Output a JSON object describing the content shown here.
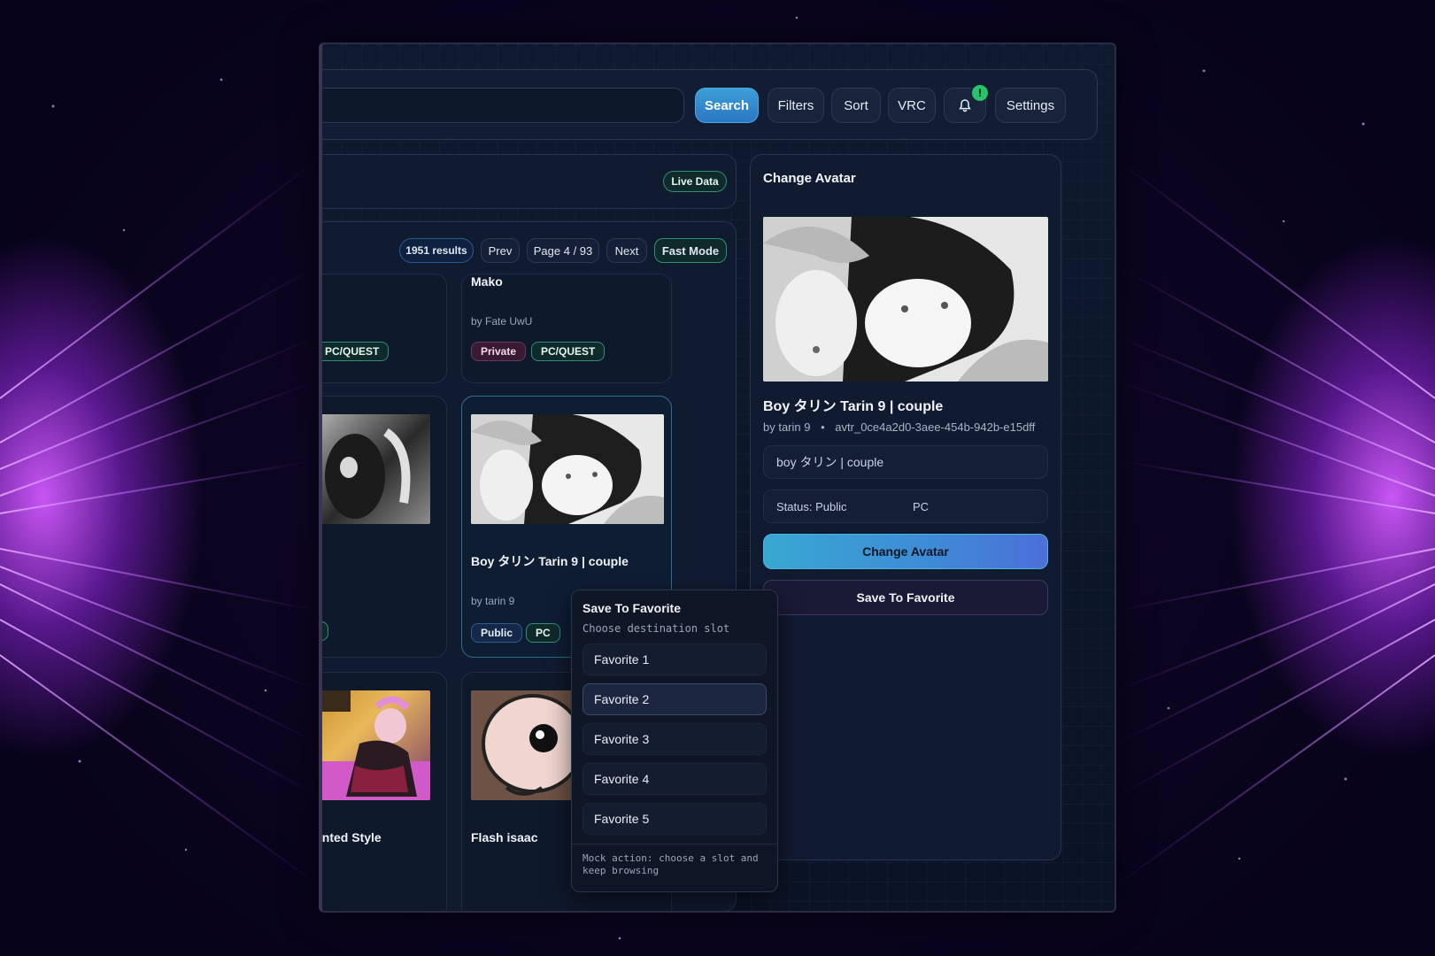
{
  "toolbar": {
    "search_placeholder": "",
    "search_label": "Search",
    "filters_label": "Filters",
    "sort_label": "Sort",
    "vrc_label": "VRC",
    "notification_badge": "!",
    "settings_label": "Settings"
  },
  "status_panel": {
    "live_label": "Live Data"
  },
  "results": {
    "count": "1951 results",
    "prev_label": "Prev",
    "page_label": "Page 4 / 93",
    "next_label": "Next",
    "fast_mode_label": "Fast Mode"
  },
  "cards": [
    {
      "title": "",
      "author": "",
      "tags": [
        "PC/QUEST"
      ]
    },
    {
      "title": "Mako",
      "author": "by Fate UwU",
      "tags": [
        "Private",
        "PC/QUEST"
      ]
    },
    {
      "title": "",
      "author": "",
      "tags": [
        "PC"
      ]
    },
    {
      "title": "Boy タリン Tarin 9  |  couple",
      "author": "by tarin 9",
      "tags": [
        "Public",
        "PC"
      ]
    },
    {
      "title": "anted Style",
      "author": ""
    },
    {
      "title": "Flash isaac",
      "author": ""
    }
  ],
  "detail": {
    "header": "Change Avatar",
    "name": "Boy タリン Tarin 9  |  couple",
    "author": "by tarin 9",
    "bullet": "•",
    "avatar_id": "avtr_0ce4a2d0-3aee-454b-942b-e15dff",
    "description": "boy タリン  |  couple",
    "status": "Status: Public",
    "platform": "PC",
    "change_label": "Change Avatar",
    "save_label": "Save To Favorite"
  },
  "favorite_menu": {
    "title": "Save To Favorite",
    "subtitle": "Choose destination slot",
    "slots": [
      "Favorite 1",
      "Favorite 2",
      "Favorite 3",
      "Favorite 4",
      "Favorite 5"
    ],
    "hovered_slot": "Favorite 2",
    "footer": "Mock action: choose a slot and keep browsing"
  },
  "colors": {
    "accent_blue": "#3d9fd8",
    "accent_green": "#27c46b",
    "glow_purple": "#b44cff"
  }
}
